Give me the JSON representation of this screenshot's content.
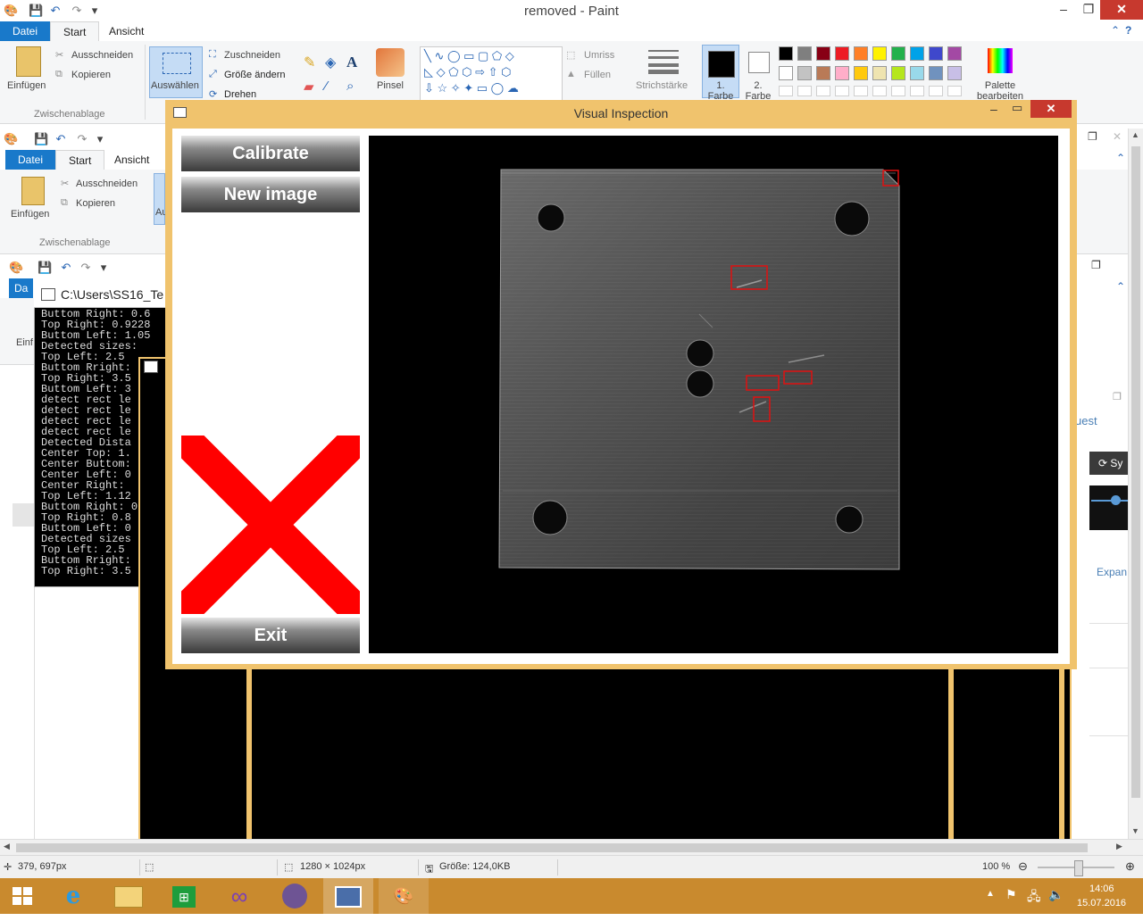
{
  "paint": {
    "title": "removed - Paint",
    "tabs": {
      "file": "Datei",
      "home": "Start",
      "view": "Ansicht"
    },
    "clipboard": {
      "paste": "Einfügen",
      "cut": "Ausschneiden",
      "copy": "Kopieren",
      "caption": "Zwischenablage"
    },
    "image": {
      "select": "Auswählen",
      "crop": "Zuschneiden",
      "resize": "Größe ändern",
      "rotate": "Drehen"
    },
    "tools": {
      "brush": "Pinsel"
    },
    "shapes": {
      "outline": "Umriss",
      "fill": "Füllen"
    },
    "stroke": "Strichstärke",
    "color1": "1. Farbe",
    "color2": "2. Farbe",
    "edit_palette": "Palette bearbeiten",
    "palette_row1": [
      "#000000",
      "#7f7f7f",
      "#880015",
      "#ed1c24",
      "#ff7f27",
      "#fff200",
      "#22b14c",
      "#00a2e8",
      "#3f48cc",
      "#a349a4"
    ],
    "palette_row2": [
      "#ffffff",
      "#c3c3c3",
      "#b97a57",
      "#ffaec9",
      "#ffc90e",
      "#efe4b0",
      "#b5e61d",
      "#99d9ea",
      "#7092be",
      "#c8bfe7"
    ],
    "status": {
      "cursor": "379, 697px",
      "dims": "1280 × 1024px",
      "size": "Größe: 124,0KB",
      "zoom": "100 %"
    }
  },
  "bg_paint2": {
    "file": "Datei",
    "home": "Start",
    "view": "Ansicht",
    "cut": "Ausschneiden",
    "copy": "Kopieren",
    "paste": "Einfügen",
    "caption": "Zwischenablage",
    "trunc": "Au"
  },
  "bg_paint3": {
    "file": "Da",
    "paste": "Einf"
  },
  "console": {
    "title": "C:\\Users\\SS16_Te",
    "lines": [
      "Buttom Right: 0.6",
      "Top Right: 0.9228",
      "Buttom Left: 1.05",
      "Detected sizes:",
      "Top Left: 2.5",
      "Buttom Rright:",
      "Top Right: 3.5",
      "Buttom Left: 3",
      "detect rect le",
      "detect rect le",
      "detect rect le",
      "detect rect le",
      "Detected Dista",
      "Center Top: 1.",
      "Center Buttom:",
      "Center Left: 0",
      "Center Right:",
      "Top Left: 1.12",
      "Buttom Right: 0",
      "Top Right: 0.8",
      "Buttom Left: 0",
      "Detected sizes",
      "Top Left: 2.5",
      "Buttom Rright:",
      "Top Right: 3.5"
    ]
  },
  "right_frag": {
    "guest": "uest",
    "sync": "Sy",
    "expand": "Expan"
  },
  "vi": {
    "title": "Visual Inspection",
    "calibrate": "Calibrate",
    "new_image": "New image",
    "exit": "Exit",
    "result": "fail",
    "result_color": "#ff0000"
  },
  "taskbar": {
    "time": "14:06",
    "date": "15.07.2016"
  }
}
